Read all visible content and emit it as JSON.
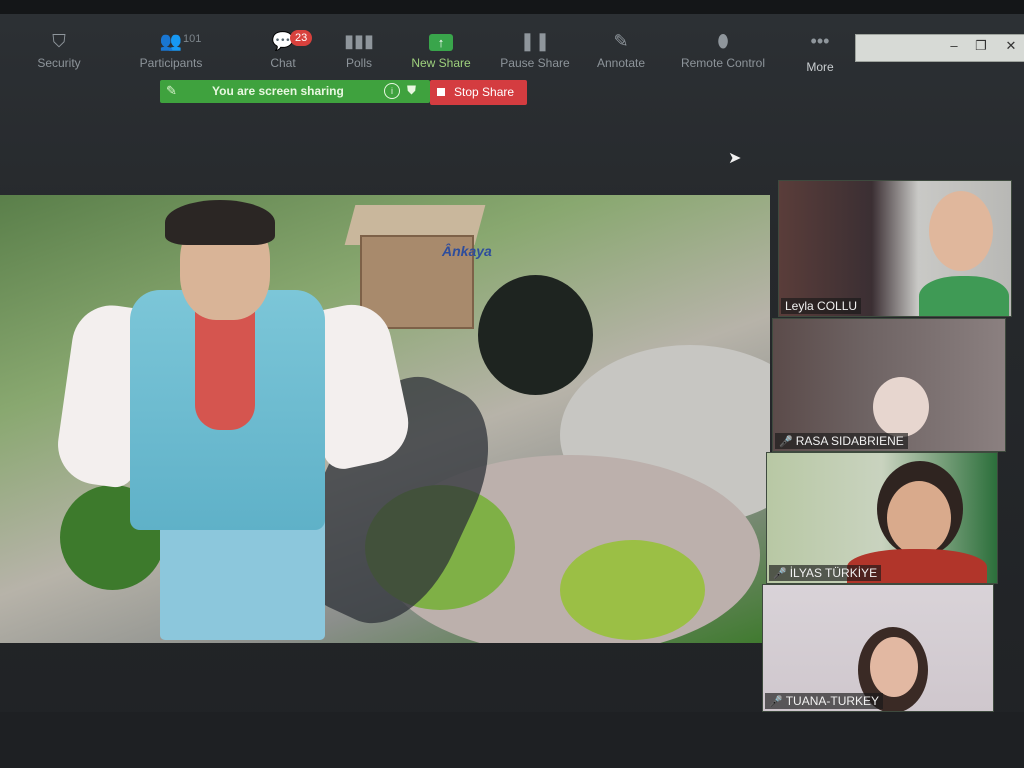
{
  "toolbar": {
    "security": "Security",
    "participants": "Participants",
    "participant_count": "101",
    "chat": "Chat",
    "chat_badge": "23",
    "polls": "Polls",
    "new_share": "New Share",
    "pause_share": "Pause Share",
    "annotate": "Annotate",
    "remote_control": "Remote Control",
    "more": "More"
  },
  "window_controls": {
    "minimize": "–",
    "restore": "❐",
    "close": "✕"
  },
  "sharing": {
    "status": "You are screen sharing",
    "stop_label": "Stop Share"
  },
  "shared_screen": {
    "sign_text": "Ânkaya"
  },
  "participants": [
    {
      "name": "Leyla COLLU",
      "muted": false
    },
    {
      "name": "RASA SIDABRIENE",
      "muted": true
    },
    {
      "name": "İLYAS TÜRKİYE",
      "muted": true
    },
    {
      "name": "TUANA-TURKEY",
      "muted": true
    }
  ],
  "colors": {
    "share_green": "#3fa23e",
    "stop_red": "#d43c40",
    "badge_red": "#d8413d",
    "mute_red": "#e04c45"
  }
}
